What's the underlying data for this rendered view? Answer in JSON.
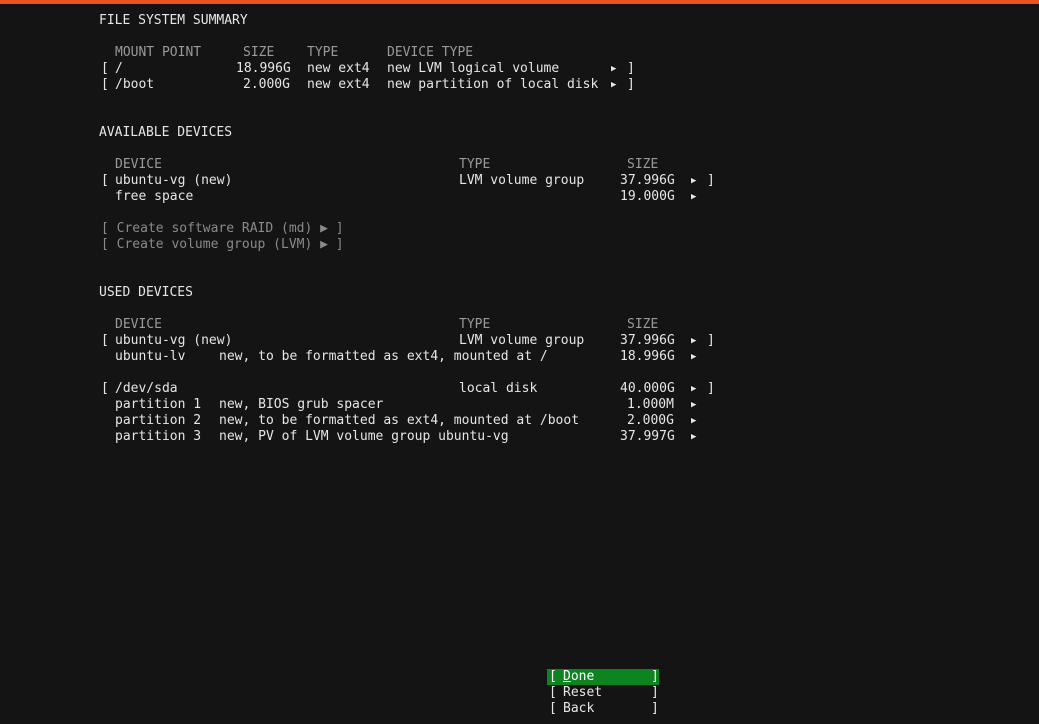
{
  "colors": {
    "background": "#141414",
    "accent_bar": "#e95420",
    "focus_button": "#0e8420"
  },
  "fs_summary": {
    "title": "FILE SYSTEM SUMMARY",
    "headers": {
      "mount": "MOUNT POINT",
      "size": "SIZE",
      "type": "TYPE",
      "device_type": "DEVICE TYPE"
    },
    "rows": [
      {
        "open": "[",
        "mount": "/",
        "size": "18.996G",
        "type": "new ext4",
        "device_type": "new LVM logical volume",
        "arrow": "▶",
        "close": "]"
      },
      {
        "open": "[",
        "mount": "/boot",
        "size": "2.000G",
        "type": "new ext4",
        "device_type": "new partition of local disk",
        "arrow": "▶",
        "close": "]"
      }
    ]
  },
  "available": {
    "title": "AVAILABLE DEVICES",
    "headers": {
      "device": "DEVICE",
      "type": "TYPE",
      "size": "SIZE"
    },
    "rows": [
      {
        "open": "[",
        "device": "ubuntu-vg (new)",
        "type": "LVM volume group",
        "size": "37.996G",
        "arrow": "▶",
        "close": "]"
      },
      {
        "device": "free space",
        "size": "19.000G",
        "arrow": "▶"
      }
    ],
    "actions": [
      "[ Create software RAID (md) ▶ ]",
      "[ Create volume group (LVM) ▶ ]"
    ]
  },
  "used": {
    "title": "USED DEVICES",
    "headers": {
      "device": "DEVICE",
      "type": "TYPE",
      "size": "SIZE"
    },
    "rows": [
      {
        "open": "[",
        "device": "ubuntu-vg (new)",
        "type": "LVM volume group",
        "size": "37.996G",
        "arrow": "▶",
        "close": "]"
      },
      {
        "device": "ubuntu-lv",
        "desc": "new, to be formatted as ext4, mounted at /",
        "size": "18.996G",
        "arrow": "▶"
      },
      {
        "open": "[",
        "device": "/dev/sda",
        "type": "local disk",
        "size": "40.000G",
        "arrow": "▶",
        "close": "]"
      },
      {
        "device": "partition 1",
        "desc": "new, BIOS grub spacer",
        "size": "1.000M",
        "arrow": "▶"
      },
      {
        "device": "partition 2",
        "desc": "new, to be formatted as ext4, mounted at /boot",
        "size": "2.000G",
        "arrow": "▶"
      },
      {
        "device": "partition 3",
        "desc": "new, PV of LVM volume group ubuntu-vg",
        "size": "37.997G",
        "arrow": "▶"
      }
    ]
  },
  "buttons": {
    "open": "[",
    "close": "]",
    "done_first": "D",
    "done_rest": "one",
    "reset": "Reset",
    "back": "Back"
  }
}
